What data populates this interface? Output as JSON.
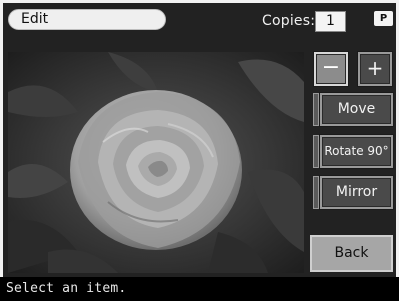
{
  "header": {
    "mode_label": "Edit",
    "copies_label": "Copies:",
    "copies_value": "1",
    "badge": "P"
  },
  "controls": {
    "zoom_out_label": "−",
    "zoom_in_label": "+",
    "move_label": "Move",
    "rotate_label": "Rotate 90°",
    "mirror_label": "Mirror",
    "back_label": "Back"
  },
  "status": {
    "message": "Select an item."
  }
}
